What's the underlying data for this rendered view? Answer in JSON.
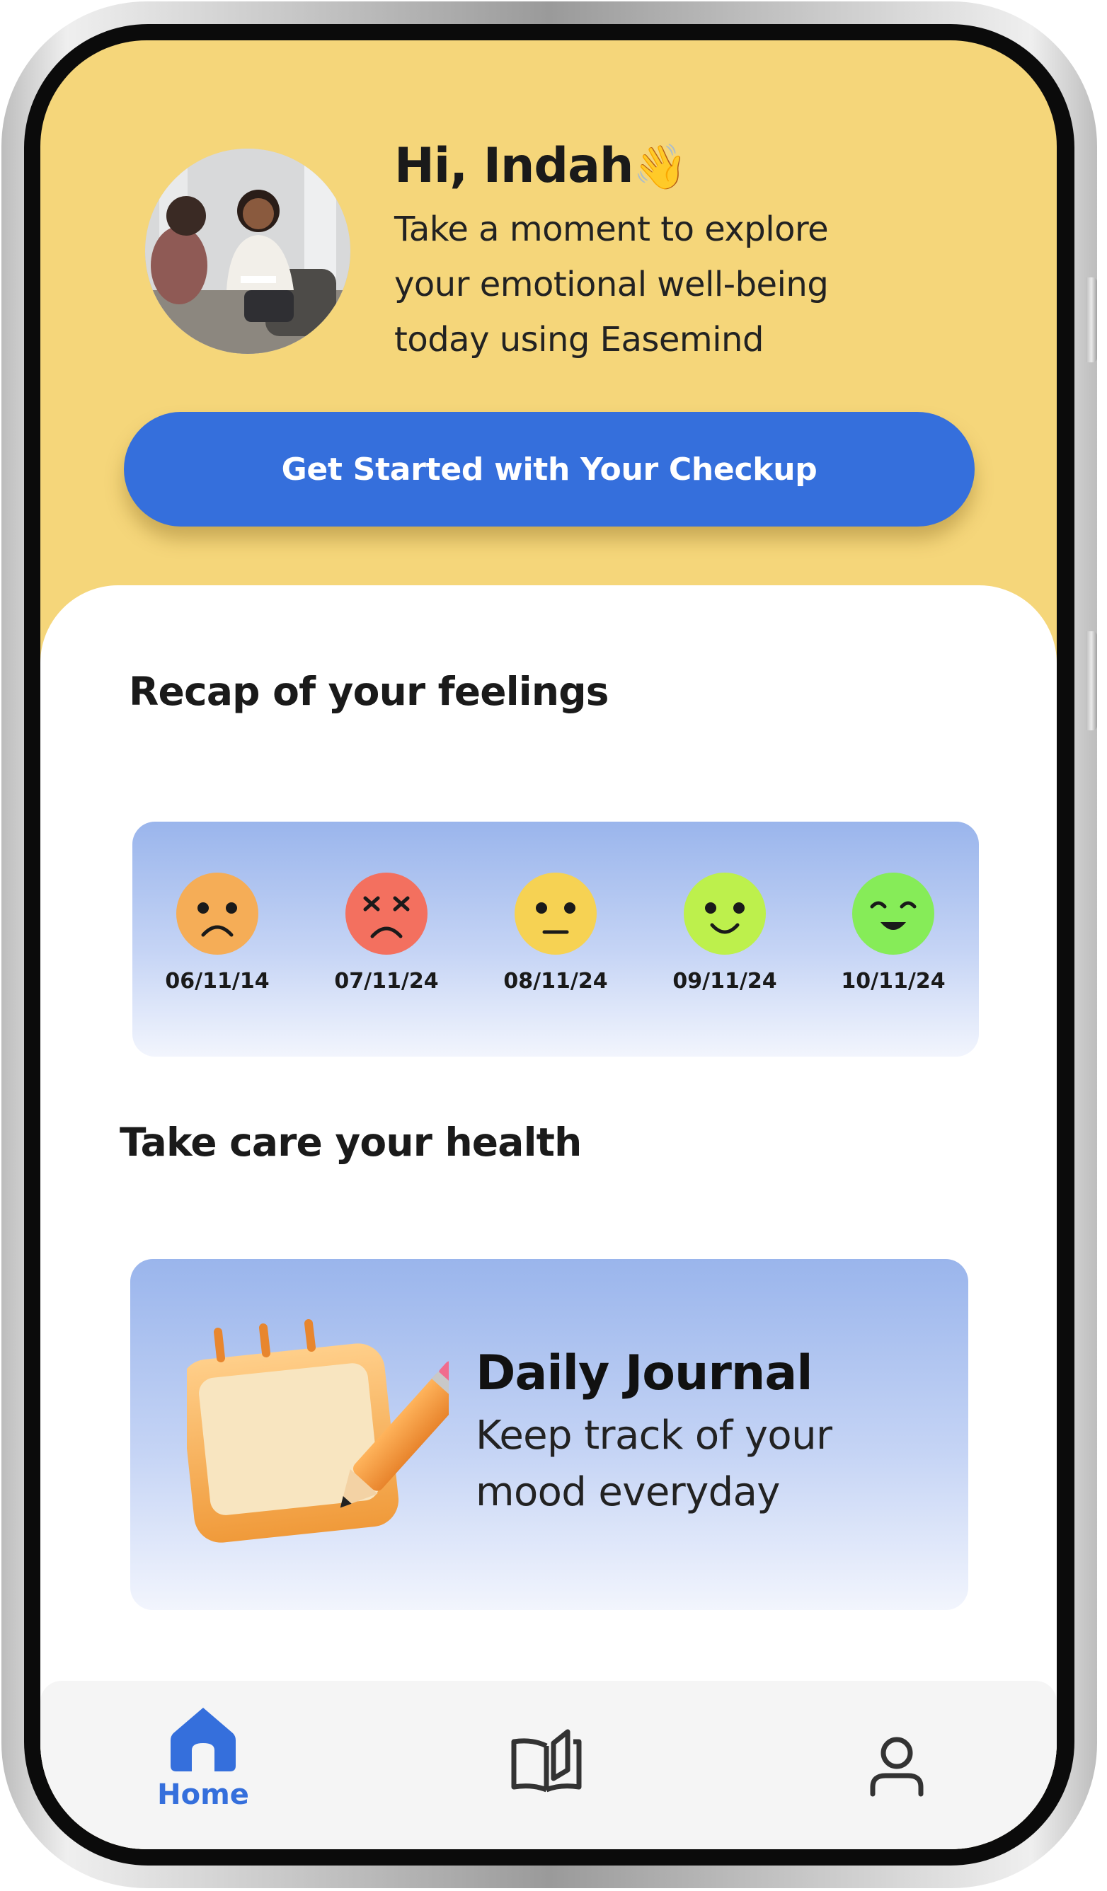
{
  "header": {
    "greeting": "Hi, Indah",
    "wave_emoji": "👋",
    "intro": "Take a moment to explore your emotional well-being today using Easemind"
  },
  "cta": {
    "label": "Get Started with Your Checkup"
  },
  "recap": {
    "title": "Recap of your feelings",
    "entries": [
      {
        "date": "06/11/14",
        "mood_icon": "sad-face-icon",
        "color": "#f5ad57"
      },
      {
        "date": "07/11/24",
        "mood_icon": "dizzy-face-icon",
        "color": "#f3705f"
      },
      {
        "date": "08/11/24",
        "mood_icon": "neutral-face-icon",
        "color": "#f6d253"
      },
      {
        "date": "09/11/24",
        "mood_icon": "smile-face-icon",
        "color": "#bdf04c"
      },
      {
        "date": "10/11/24",
        "mood_icon": "happy-face-icon",
        "color": "#86ec58"
      }
    ]
  },
  "health": {
    "title": "Take care your health",
    "journal": {
      "title": "Daily Journal",
      "description": "Keep track of your mood everyday",
      "icon": "calendar-pencil-icon"
    }
  },
  "nav": {
    "home_label": "Home",
    "active": "home",
    "accent": "#356fdc",
    "items": [
      "home-icon",
      "book-icon",
      "profile-icon"
    ]
  }
}
